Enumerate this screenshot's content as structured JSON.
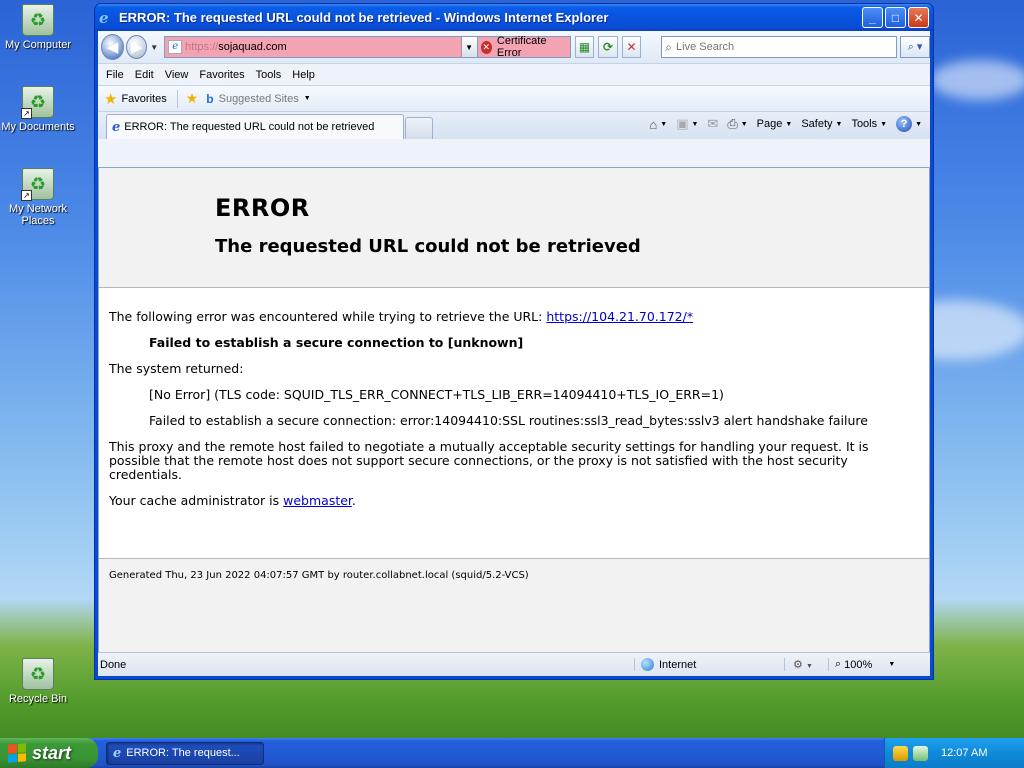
{
  "desktop": {
    "icons": [
      {
        "label": "My Computer"
      },
      {
        "label": "My Documents"
      },
      {
        "label": "My Network Places"
      },
      {
        "label": "Recycle Bin"
      }
    ]
  },
  "window": {
    "title": "ERROR: The requested URL could not be retrieved - Windows Internet Explorer",
    "minimize": "_",
    "maximize": "□",
    "close": "✕"
  },
  "address": {
    "prefix": "https://",
    "host": "sojaquad.com",
    "cert_error": "Certificate Error",
    "search_placeholder": "Live Search"
  },
  "menu": [
    "File",
    "Edit",
    "View",
    "Favorites",
    "Tools",
    "Help"
  ],
  "favorites_bar": {
    "favorites_label": "Favorites",
    "suggested_label": "Suggested Sites"
  },
  "tab": {
    "label": "ERROR: The requested URL could not be retrieved"
  },
  "commands": {
    "page": "Page",
    "safety": "Safety",
    "tools": "Tools"
  },
  "page": {
    "heading": "ERROR",
    "subheading": "The requested URL could not be retrieved",
    "intro": "The following error was encountered while trying to retrieve the URL:",
    "url": "https://104.21.70.172/*",
    "failure": "Failed to establish a secure connection to [unknown]",
    "system_returned": "The system returned:",
    "tls_code": "[No Error] (TLS code: SQUID_TLS_ERR_CONNECT+TLS_LIB_ERR=14094410+TLS_IO_ERR=1)",
    "ssl_error": "Failed to establish a secure connection: error:14094410:SSL routines:ssl3_read_bytes:sslv3 alert handshake failure",
    "explanation": "This proxy and the remote host failed to negotiate a mutually acceptable security settings for handling your request. It is possible that the remote host does not support secure connections, or the proxy is not satisfied with the host security credentials.",
    "admin_prefix": "Your cache administrator is",
    "admin_link": "webmaster",
    "admin_suffix": ".",
    "footer": "Generated Thu, 23 Jun 2022 04:07:57 GMT by router.collabnet.local (squid/5.2-VCS)"
  },
  "status": {
    "text": "Done",
    "zone": "Internet",
    "zoom": "100%"
  },
  "taskbar": {
    "start": "start",
    "task_label": "ERROR: The request...",
    "clock": "12:07 AM"
  }
}
